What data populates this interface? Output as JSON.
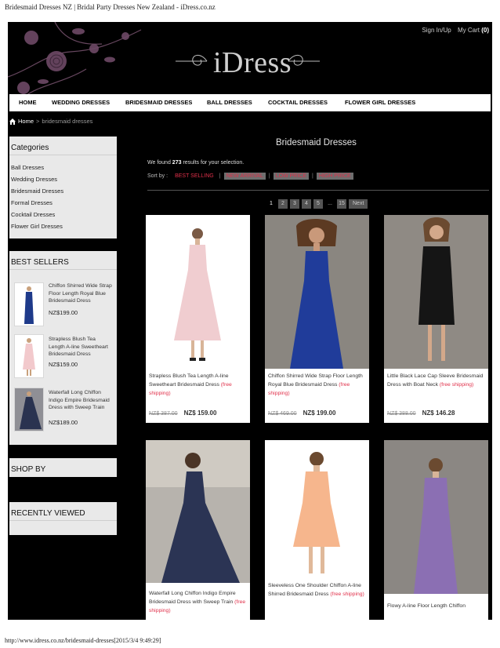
{
  "document": {
    "title": "Bridesmaid Dresses NZ | Bridal Party Dresses New Zealand - iDress.co.nz",
    "footer_url": "http://www.idress.co.nz/bridesmaid-dresses[2015/3/4 9:49:29]"
  },
  "header": {
    "logo": "iDress",
    "sign_in": "Sign In/Up",
    "cart_label": "My Cart",
    "cart_count": "(0)"
  },
  "nav": {
    "items": [
      "HOME",
      "WEDDING DRESSES",
      "BRIDESMAID DRESSES",
      "BALL DRESSES",
      "COCKTAIL DRESSES",
      "FLOWER GIRL DRESSES"
    ]
  },
  "breadcrumb": {
    "home": "Home",
    "sep": ">",
    "current": "bridesmaid dresses"
  },
  "sidebar": {
    "categories_title": "Categories",
    "categories": [
      "Ball Dresses",
      "Wedding Dresses",
      "Bridesmaid Dresses",
      "Formal Dresses",
      "Cocktail Dresses",
      "Flower Girl Dresses"
    ],
    "best_sellers_title": "BEST SELLERS",
    "best_sellers": [
      {
        "name": "Chiffon Shirred Wide Strap Floor Length Royal Blue Bridesmaid Dress",
        "price": "NZ$199.00",
        "color": "#1e3a8a"
      },
      {
        "name": "Strapless Blush Tea Length A-line Sweetheart Bridesmaid Dress",
        "price": "NZ$159.00",
        "color": "#f2c9cc"
      },
      {
        "name": "Waterfall Long Chiffon Indigo Empire Bridesmaid Dress with Sweep Train",
        "price": "NZ$189.00",
        "color": "#2a3350"
      }
    ],
    "shop_by_title": "SHOP BY",
    "recently_viewed_title": "RECENTLY VIEWED"
  },
  "main": {
    "title": "Bridesmaid Dresses",
    "found_prefix": "We found",
    "found_count": "273",
    "found_suffix": "results for your selection.",
    "sort_label": "Sort by :",
    "sort_options": [
      "BEST SELLING",
      "NEW ARRIVAL",
      "LOW PRICE",
      "HIGH PRICE"
    ],
    "sort_sep": "|",
    "pagination": [
      "1",
      "2",
      "3",
      "4",
      "5",
      "...",
      "15",
      "Next"
    ],
    "products": [
      {
        "name": "Strapless Blush Tea Length A-line Sweetheart Bridesmaid Dress",
        "free": "(free shipping)",
        "old_price": "NZ$ 387.00",
        "price_prefix": "NZ$",
        "price": "159.00",
        "color": "#f0cdd0",
        "bg": "#ffffff"
      },
      {
        "name": "Chiffon Shirred Wide Strap Floor Length Royal Blue Bridesmaid Dress",
        "free": "(free shipping)",
        "old_price": "NZ$ 469.00",
        "price_prefix": "NZ$",
        "price": "199.00",
        "color": "#203c9a",
        "bg": "#8a8680"
      },
      {
        "name": "Little Black Lace Cap Sleeve Bridesmaid Dress with Boat Neck",
        "free": "(free shipping)",
        "old_price": "NZ$ 388.00",
        "price_prefix": "NZ$",
        "price": "146.28",
        "color": "#151515",
        "bg": "#8f8a84"
      },
      {
        "name": "Waterfall Long Chiffon Indigo Empire Bridesmaid Dress with Sweep Train",
        "free": "(free shipping)",
        "color": "#2b3454",
        "bg": "#b7b3ad"
      },
      {
        "name": "Sleeveless One Shoulder Chiffon A-line Shirred Bridesmaid Dress",
        "free": "(free shipping)",
        "color": "#f6b68d",
        "bg": "#ffffff"
      },
      {
        "name": "Flowy A-line Floor Length Chiffon",
        "free": "",
        "color": "#8b6fb3",
        "bg": "#8b8783"
      }
    ]
  }
}
